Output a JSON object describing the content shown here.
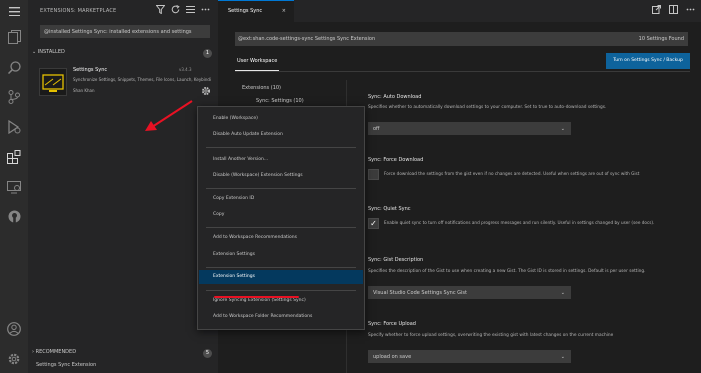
{
  "activity_bar": {
    "icons": [
      "menu-icon",
      "files-icon",
      "search-icon",
      "source-control-icon",
      "run-debug-icon",
      "extensions-icon",
      "remote-explorer-icon",
      "github-icon"
    ],
    "bottom_icons": [
      "account-icon",
      "manage-icon"
    ]
  },
  "sidebar": {
    "title": "EXTENSIONS: MARKETPLACE",
    "search_value": "@installed Settings Sync: installed extensions and settings",
    "section_installed": "INSTALLED",
    "installed_count": "1",
    "extension": {
      "name": "Settings Sync",
      "version": "v3.4.3",
      "description": "Synchronize Settings, Snippets, Themes, File Icons, Launch, Keybindings",
      "publisher": "Shan Khan"
    },
    "section_recommended": "RECOMMENDED",
    "recommended_count": "5",
    "bottom_item": "Settings Sync Extension"
  },
  "editor": {
    "tab_label": "Settings Sync",
    "tab_close": "×",
    "settings_search": "@ext:shan.code-settings-sync Settings Sync Extension",
    "settings_count": "10 Settings Found",
    "tab_user": "User Workspace",
    "sync_button": "Turn on Settings Sync / Backup",
    "toc": [
      "Extensions (10)",
      "Sync: Settings (10)"
    ],
    "settings": [
      {
        "title": "Sync: Auto Download",
        "desc": "Specifies whether to automatically download settings to your computer. Set to true to auto-download settings.",
        "value": "off"
      },
      {
        "title": "Sync: Force Download",
        "desc": "Force download the settings from the gist even if no changes are detected. Useful when settings are out of sync with Gist"
      },
      {
        "title": "Sync: Quiet Sync",
        "desc": "Enable quiet sync to turn off notifications and progress messages and run silently. Useful in settings changed by user (see docs).",
        "checked": true
      },
      {
        "title": "Sync: Gist Description",
        "desc": "Specifies the description of the Gist to use when creating a new Gist. The Gist ID is stored in settings. Default is per user setting.",
        "value": "Visual Studio Code Settings Sync Gist"
      },
      {
        "title": "Sync: Force Upload",
        "desc": "Specify whether to force upload settings, overwriting the existing gist with latest changes on the current machine",
        "value": "upload on save"
      }
    ]
  },
  "context_menu": {
    "items": [
      "Enable (Workspace)",
      "Disable Auto Update Extension",
      "Install Another Version...",
      "Disable (Workspace) Extension Settings",
      "Copy Extension ID",
      "Copy",
      "Add to Workspace Recommendations",
      "Extension Settings",
      "Ignore Syncing Extension (Settings Sync)",
      "Add to Workspace Folder Recommendations"
    ],
    "selected_index": 7
  },
  "colors": {
    "accent": "#0078d4",
    "highlight_underline": "#e81123",
    "arrow": "#e81123",
    "selected_item_bg": "#04395e"
  }
}
